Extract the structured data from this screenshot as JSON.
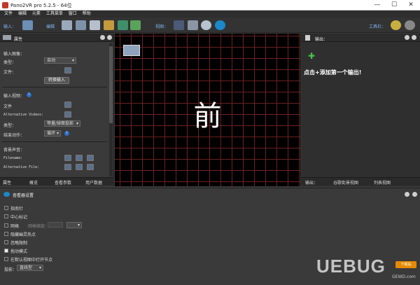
{
  "window": {
    "title": "Pano2VR pro 5.2.5 - 64位",
    "minimize": "—",
    "maximize": "☐",
    "close": "✕"
  },
  "menu": [
    "文件",
    "编辑",
    "元素",
    "工具菜单",
    "窗口",
    "帮助"
  ],
  "toolbar": {
    "input_label": "输入：",
    "edit_label": "编辑",
    "view_label": "视图：",
    "tools_label": "工具栏："
  },
  "left_panel": {
    "title": "属性",
    "input_image_header": "输入图像：",
    "type_label": "类型：",
    "type_value": "自动",
    "file_label": "文件：",
    "convert_button": "转换输入",
    "input_video_header": "输入视频：",
    "video_file_label": "文件",
    "alt_videos_label": "Alternative Videos:",
    "video_type_label": "类型：",
    "video_type_value": "等量/球面投影",
    "end_action_label": "结束动作：",
    "end_action_value": "循环",
    "bg_sound_header": "背景声音：",
    "filename_label": "Filename:",
    "alt_file_label": "Alternative File:",
    "tabs": [
      "属性",
      "概览",
      "查看参数",
      "用户数据"
    ]
  },
  "center": {
    "face_text": "前"
  },
  "right_panel": {
    "title": "输出：",
    "hint": "点击+添加第一个输出!",
    "tabs": [
      "输出：",
      "谷歌街景视图",
      "列表视图"
    ]
  },
  "bottom_panel": {
    "title": "查看器设置",
    "options": [
      {
        "label": "指南针",
        "checked": false
      },
      {
        "label": "中心标记",
        "checked": false
      },
      {
        "label": "网格",
        "checked": false
      },
      {
        "label": "隐藏幽灵热点",
        "checked": false
      },
      {
        "label": "忽略限制",
        "checked": false
      },
      {
        "label": "拖动模式",
        "checked": true
      },
      {
        "label": "在默认视图中打开节点",
        "checked": false
      }
    ],
    "grid_zoom_label": "网格缩放：",
    "projection_label": "投影：",
    "projection_value": "直线型"
  },
  "watermark": {
    "text": "UEBUG",
    "badge": "下载站",
    "site": "GEWD.com"
  }
}
